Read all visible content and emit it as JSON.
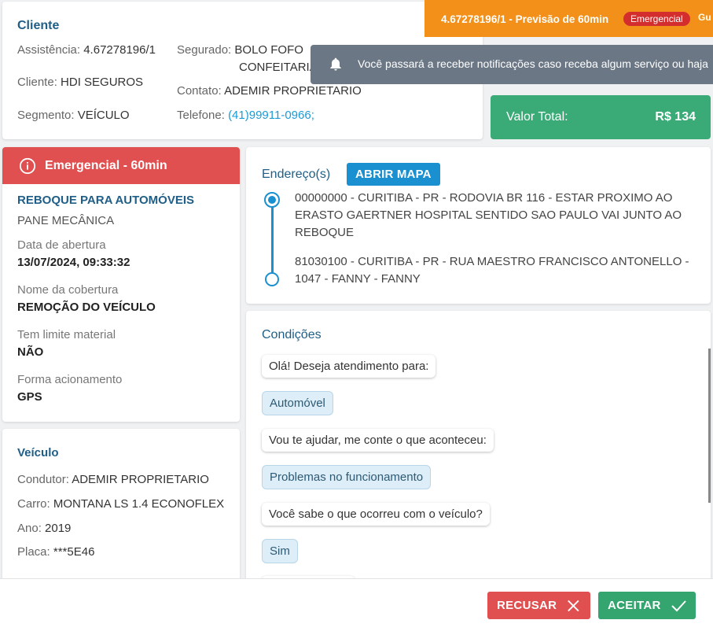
{
  "client": {
    "title": "Cliente",
    "assistencia_label": "Assistência:",
    "assistencia_value": "4.67278196/1",
    "cliente_label": "Cliente:",
    "cliente_value": "HDI SEGUROS",
    "segmento_label": "Segmento:",
    "segmento_value": "VEÍCULO",
    "segurado_label": "Segurado:",
    "segurado_value_line1": "BOLO FOFO",
    "segurado_value_line2": "CONFEITARIA",
    "contato_label": "Contato:",
    "contato_value": "ADEMIR PROPRIETARIO",
    "telefone_label": "Telefone:",
    "telefone_value": "(41)99911-0966;"
  },
  "banner": {
    "sub_text": "4.67278196/1 - Previsão de 60min",
    "badge": "Emergencial",
    "badge2": "Gu"
  },
  "notification": {
    "message": "Você passará a receber notificações caso receba algum serviço ou haja"
  },
  "total": {
    "label": "Valor Total:",
    "value": "R$ 134"
  },
  "service": {
    "header": "Emergencial - 60min",
    "type": "REBOQUE PARA AUTOMÓVEIS",
    "problem": "PANE MECÂNICA",
    "data_label": "Data de abertura",
    "data_value": "13/07/2024, 09:33:32",
    "cobertura_label": "Nome da cobertura",
    "cobertura_value": "REMOÇÃO DO VEÍCULO",
    "limite_label": "Tem limite material",
    "limite_value": "NÃO",
    "forma_label": "Forma acionamento",
    "forma_value": "GPS"
  },
  "vehicle": {
    "title": "Veículo",
    "condutor_label": "Condutor:",
    "condutor_value": "ADEMIR PROPRIETARIO",
    "carro_label": "Carro:",
    "carro_value": "MONTANA LS 1.4 ECONOFLEX",
    "ano_label": "Ano:",
    "ano_value": "2019",
    "placa_label": "Placa:",
    "placa_value": "***5E46"
  },
  "address": {
    "title": "Endereço(s)",
    "map_button": "ABRIR MAPA",
    "origin": "00000000 - CURITIBA - PR - RODOVIA BR 116 - ESTAR PROXIMO AO ERASTO GAERTNER HOSPITAL SENTIDO SAO PAULO VAI JUNTO AO REBOQUE",
    "destination": "81030100 - CURITIBA - PR - RUA MAESTRO FRANCISCO ANTONELLO - 1047 - FANNY - FANNY"
  },
  "conditions": {
    "title": "Condições",
    "messages": [
      {
        "kind": "q",
        "text": "Olá! Deseja atendimento para:"
      },
      {
        "kind": "a",
        "text": "Automóvel"
      },
      {
        "kind": "q",
        "text": "Vou te ajudar, me conte o que aconteceu:"
      },
      {
        "kind": "a",
        "text": "Problemas no funcionamento"
      },
      {
        "kind": "q",
        "text": "Você sabe o que ocorreu com o veículo?"
      },
      {
        "kind": "a",
        "text": "Sim"
      }
    ]
  },
  "footer": {
    "refuse": "RECUSAR",
    "accept": "ACEITAR"
  },
  "colors": {
    "accent_blue": "#1a90d0",
    "danger": "#e05050",
    "success": "#35a56f",
    "orange": "#f39019"
  }
}
